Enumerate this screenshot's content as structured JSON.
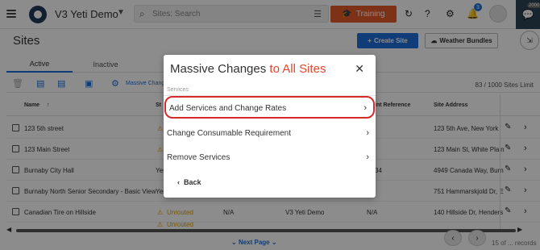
{
  "app": {
    "name": "V3 Yeti Demo"
  },
  "search": {
    "placeholder": "Sites: Search"
  },
  "topbar": {
    "training_label": "Training",
    "notification_count": "3",
    "message_count": "2000"
  },
  "page": {
    "title": "Sites",
    "create_label": "Create Site",
    "weather_label": "Weather Bundles"
  },
  "tabs": [
    {
      "label": "Active"
    },
    {
      "label": "Inactive"
    }
  ],
  "toolbar": {
    "massive_label": "Massive Changes",
    "site_count": "83 / 1000 Sites Limit"
  },
  "table": {
    "headers": {
      "name": "Name",
      "status": "St",
      "account": "int Reference",
      "address": "Site Address"
    },
    "rows": [
      {
        "name": "123 5th street",
        "status": "",
        "account": "",
        "reference": "",
        "address": "123 5th Ave, New York"
      },
      {
        "name": "123 Main Street",
        "status": "",
        "account": "",
        "reference": "",
        "address": "123 Main St, White Plain"
      },
      {
        "name": "Burnaby City Hall",
        "status": "Yes",
        "account": "",
        "reference": "34",
        "address": "4949 Canada Way, Burn"
      },
      {
        "name": "Burnaby North Senior Secondary - Basic View",
        "status": "Yes",
        "account": "",
        "reference": "",
        "address": "751 Hammarskjold Dr, E"
      },
      {
        "name": "Canadian Tire on Hillside",
        "status": "Unrouted",
        "account": "N/A",
        "org": "V3 Yeti Demo",
        "reference": "N/A",
        "address": "140 Hillside Dr, Henders"
      },
      {
        "name": "",
        "status": "Unrouted",
        "account": "",
        "reference": "",
        "address": ""
      }
    ]
  },
  "footer": {
    "next_label": "Next Page",
    "page_info": "15 of ... records"
  },
  "modal": {
    "title_prefix": "Massive Changes ",
    "title_accent": "to All Sites",
    "section": "Services",
    "items": [
      {
        "label": "Add Services and Change Rates"
      },
      {
        "label": "Change Consumable Requirement"
      },
      {
        "label": "Remove Services"
      }
    ],
    "back_label": "Back"
  },
  "colors": {
    "accent": "#1e6fd9",
    "training": "#e35a2a",
    "highlight": "#d62b2b",
    "title_accent": "#e2462c"
  },
  "icons": [
    "menu-icon",
    "logo-icon",
    "search-icon",
    "filter-icon",
    "graduation-cap-icon",
    "refresh-icon",
    "help-icon",
    "gear-icon",
    "bell-icon",
    "avatar",
    "chat-icon",
    "plus-icon",
    "cloud-icon",
    "trash-icon",
    "file-icon",
    "sort-up-icon",
    "warning-icon",
    "pencil-icon",
    "chevron-right-icon",
    "close-icon",
    "chevron-left-icon",
    "chevron-down-icon"
  ]
}
